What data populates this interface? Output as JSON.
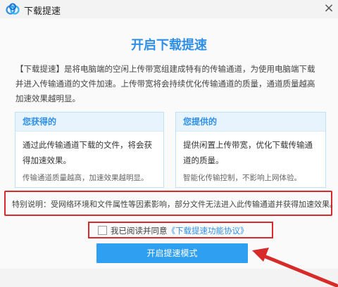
{
  "window": {
    "title": "下载提速",
    "close_glyph": "×"
  },
  "main": {
    "heading": "开启下载提速",
    "description_lines": [
      "【下载提速】是将电脑端的空闲上传带宽组建成特有的传输通道，为使用电脑端下载",
      "并进入传输通道的文件加速。上传带宽将会持续优化传输通道的质量，通道质量越高",
      "加速效果越明显。"
    ]
  },
  "cards": {
    "get": {
      "title": "您获得的",
      "body_lines": [
        "通过此传输通道下载的文件，将会获",
        "得加速效果。"
      ],
      "note": "传输通道质量越高，加速效果越明显。"
    },
    "give": {
      "title": "您提供的",
      "body_lines": [
        "提供闲置上传带宽，优化下载传输通",
        "道的质量。"
      ],
      "note": "智能化传输控制，不影响上网体验。"
    }
  },
  "special_note": "特别说明：受网络环境和文件属性等因素影响，部分文件无法进入此传输通道并获得加速效果。",
  "agreement": {
    "checked": false,
    "text": "我已阅读并同意",
    "link": "《下载提速功能协议》"
  },
  "primary_button": "开启提速模式",
  "colors": {
    "accent": "#2f8fe6",
    "button": "#2f9ff2",
    "highlight_border": "#d72a2a"
  }
}
